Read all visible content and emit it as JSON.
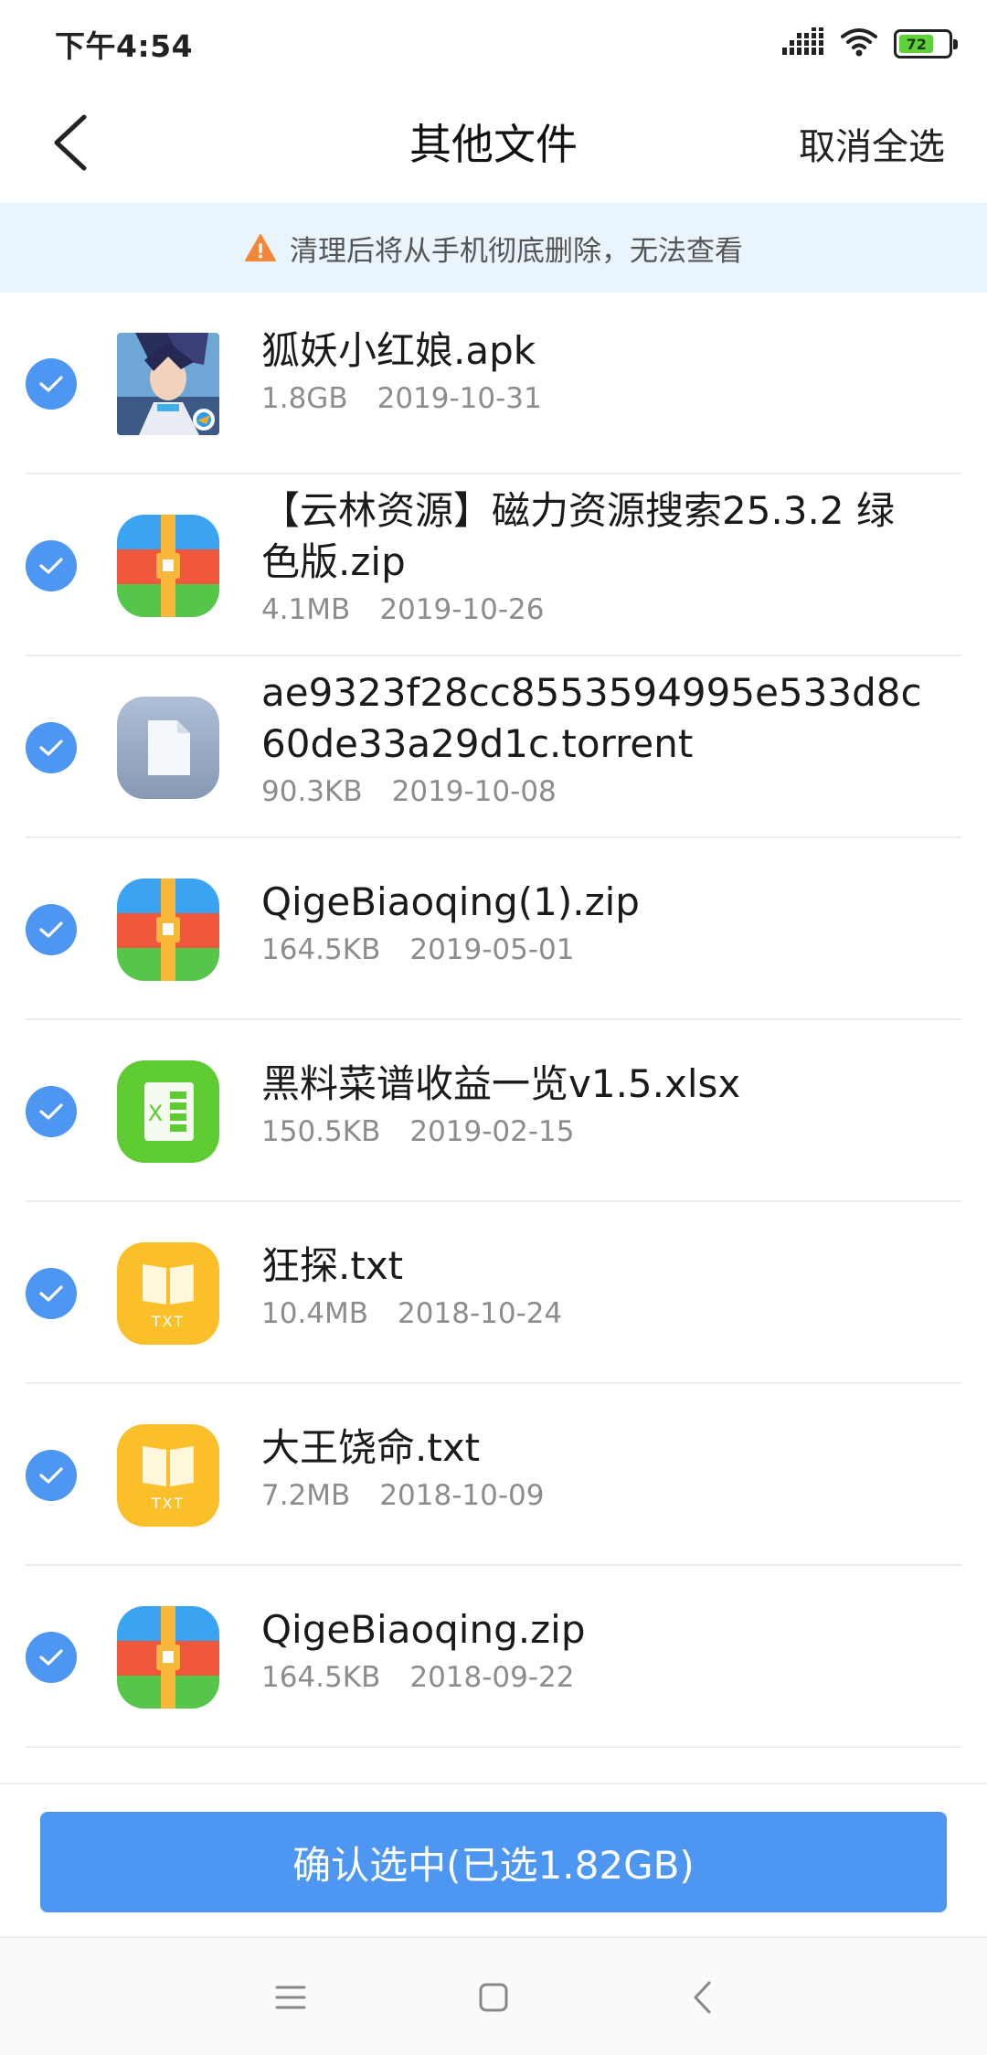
{
  "status_bar": {
    "time": "下午4:54",
    "battery": "72",
    "icons": [
      "signal-icon",
      "wifi-icon",
      "battery-icon"
    ]
  },
  "header": {
    "back_icon": "chevron-left-icon",
    "title": "其他文件",
    "deselect_all": "取消全选"
  },
  "warning": {
    "icon": "warning-triangle-icon",
    "text": "清理后将从手机彻底删除，无法查看",
    "color": "#f5873b"
  },
  "files": [
    {
      "name": "狐妖小红娘.apk",
      "size": "1.8GB",
      "date": "2019-10-31",
      "icon": "app-thumbnail-icon",
      "checked": true
    },
    {
      "name": "【云林资源】磁力资源搜索25.3.2 绿色版.zip",
      "size": "4.1MB",
      "date": "2019-10-26",
      "icon": "zip-icon",
      "checked": true
    },
    {
      "name": "ae9323f28cc8553594995e533d8c60de33a29d1c.torrent",
      "size": "90.3KB",
      "date": "2019-10-08",
      "icon": "document-icon",
      "checked": true
    },
    {
      "name": "QigeBiaoqing(1).zip",
      "size": "164.5KB",
      "date": "2019-05-01",
      "icon": "zip-icon",
      "checked": true
    },
    {
      "name": "黑料菜谱收益一览v1.5.xlsx",
      "size": "150.5KB",
      "date": "2019-02-15",
      "icon": "excel-icon",
      "checked": true
    },
    {
      "name": "狂探.txt",
      "size": "10.4MB",
      "date": "2018-10-24",
      "icon": "txt-icon",
      "checked": true
    },
    {
      "name": "大王饶命.txt",
      "size": "7.2MB",
      "date": "2018-10-09",
      "icon": "txt-icon",
      "checked": true
    },
    {
      "name": "QigeBiaoqing.zip",
      "size": "164.5KB",
      "date": "2018-09-22",
      "icon": "zip-icon",
      "checked": true
    }
  ],
  "confirm_button": "确认选中(已选1.82GB)",
  "nav_bar": [
    "menu-icon",
    "home-icon",
    "back-icon"
  ],
  "colors": {
    "accent": "#4d96f2",
    "banner_bg": "#eaf4fc",
    "txt_icon": "#fbbf2a",
    "excel_icon": "#5fcb32"
  }
}
